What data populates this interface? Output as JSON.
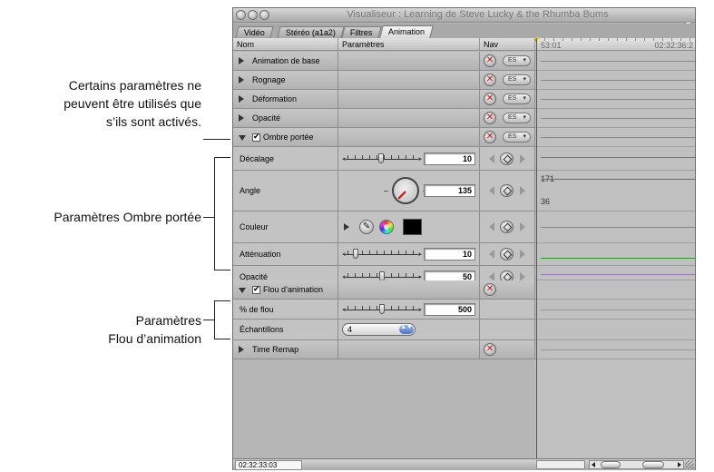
{
  "callouts": {
    "activated": [
      "Certains paramètres ne",
      "peuvent être utilisés que",
      "s’ils sont activés."
    ],
    "drop_shadow": "Paramètres Ombre portée",
    "motion_blur": [
      "Paramètres",
      "Flou d’animation"
    ]
  },
  "window": {
    "title": "Visualiseur : Learning de Steve Lucky & the Rhumba Bums",
    "tabs": [
      "Vidéo",
      "Stéréo (a1a2)",
      "Filtres",
      "Animation"
    ],
    "active_tab": "Animation"
  },
  "columns": {
    "name": "Nom",
    "params": "Paramètres",
    "nav": "Nav"
  },
  "ruler": {
    "start": "53:01",
    "end": "02:32:36:2"
  },
  "groups": {
    "basic": "Animation de base",
    "crop": "Rognage",
    "distort": "Déformation",
    "opacity": "Opacité",
    "drop_shadow": "Ombre portée",
    "motion_blur": "Flou d’animation",
    "time_remap": "Time Remap"
  },
  "drop_shadow_params": {
    "offset": {
      "label": "Décalage",
      "value": "10",
      "slider_fraction": 0.48
    },
    "angle": {
      "label": "Angle",
      "value": "135"
    },
    "color": {
      "label": "Couleur",
      "swatch": "#000000"
    },
    "softness": {
      "label": "Atténuation",
      "value": "10",
      "slider_fraction": 0.1
    },
    "opacity": {
      "label": "Opacité",
      "value": "50",
      "slider_fraction": 0.5
    }
  },
  "motion_blur_params": {
    "blur_amount": {
      "label": "% de flou",
      "value": "500",
      "slider_fraction": 0.5
    },
    "samples": {
      "label": "Échantillons",
      "value": "4"
    }
  },
  "timeline_values": {
    "angle_top": "171",
    "angle_bottom": "36"
  },
  "footer": {
    "timecode": "02:32:33:03"
  },
  "icons": {
    "menu_button": "ES",
    "eyedropper": "✎",
    "stepper": "▲▼"
  },
  "colors": {
    "keyframe_line": "#2f9a2f",
    "offset_line": "#36a336",
    "reset_red": "#c21010"
  }
}
